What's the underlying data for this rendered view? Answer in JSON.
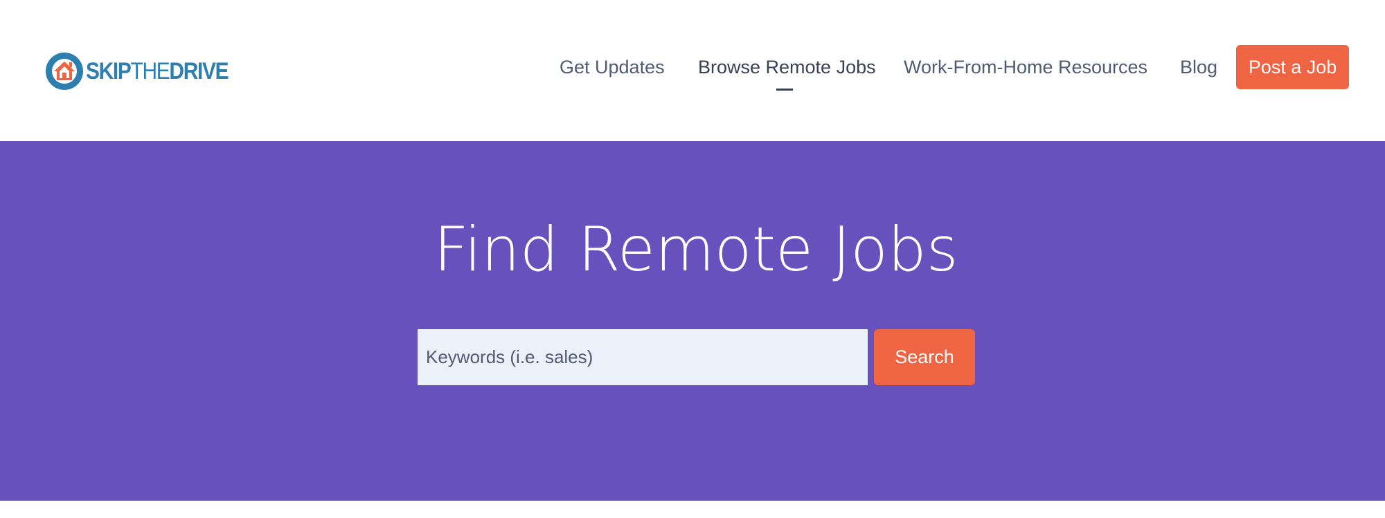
{
  "brand": {
    "name_bold_1": "SKIP",
    "name_thin": "THE",
    "name_bold_2": "DRIVE",
    "colors": {
      "primary": "#2e7fb0",
      "accent": "#ef6443",
      "hero": "#6651bd"
    },
    "icon": "house-circle-logo-icon"
  },
  "nav": {
    "items": [
      {
        "label": "Get Updates",
        "active": false
      },
      {
        "label": "Browse Remote Jobs",
        "active": true
      },
      {
        "label": "Work-From-Home Resources",
        "active": false
      },
      {
        "label": "Blog",
        "active": false
      }
    ],
    "cta_label": "Post a Job"
  },
  "hero": {
    "title": "Find Remote Jobs",
    "search": {
      "placeholder": "Keywords (i.e. sales)",
      "value": "",
      "button_label": "Search"
    }
  }
}
